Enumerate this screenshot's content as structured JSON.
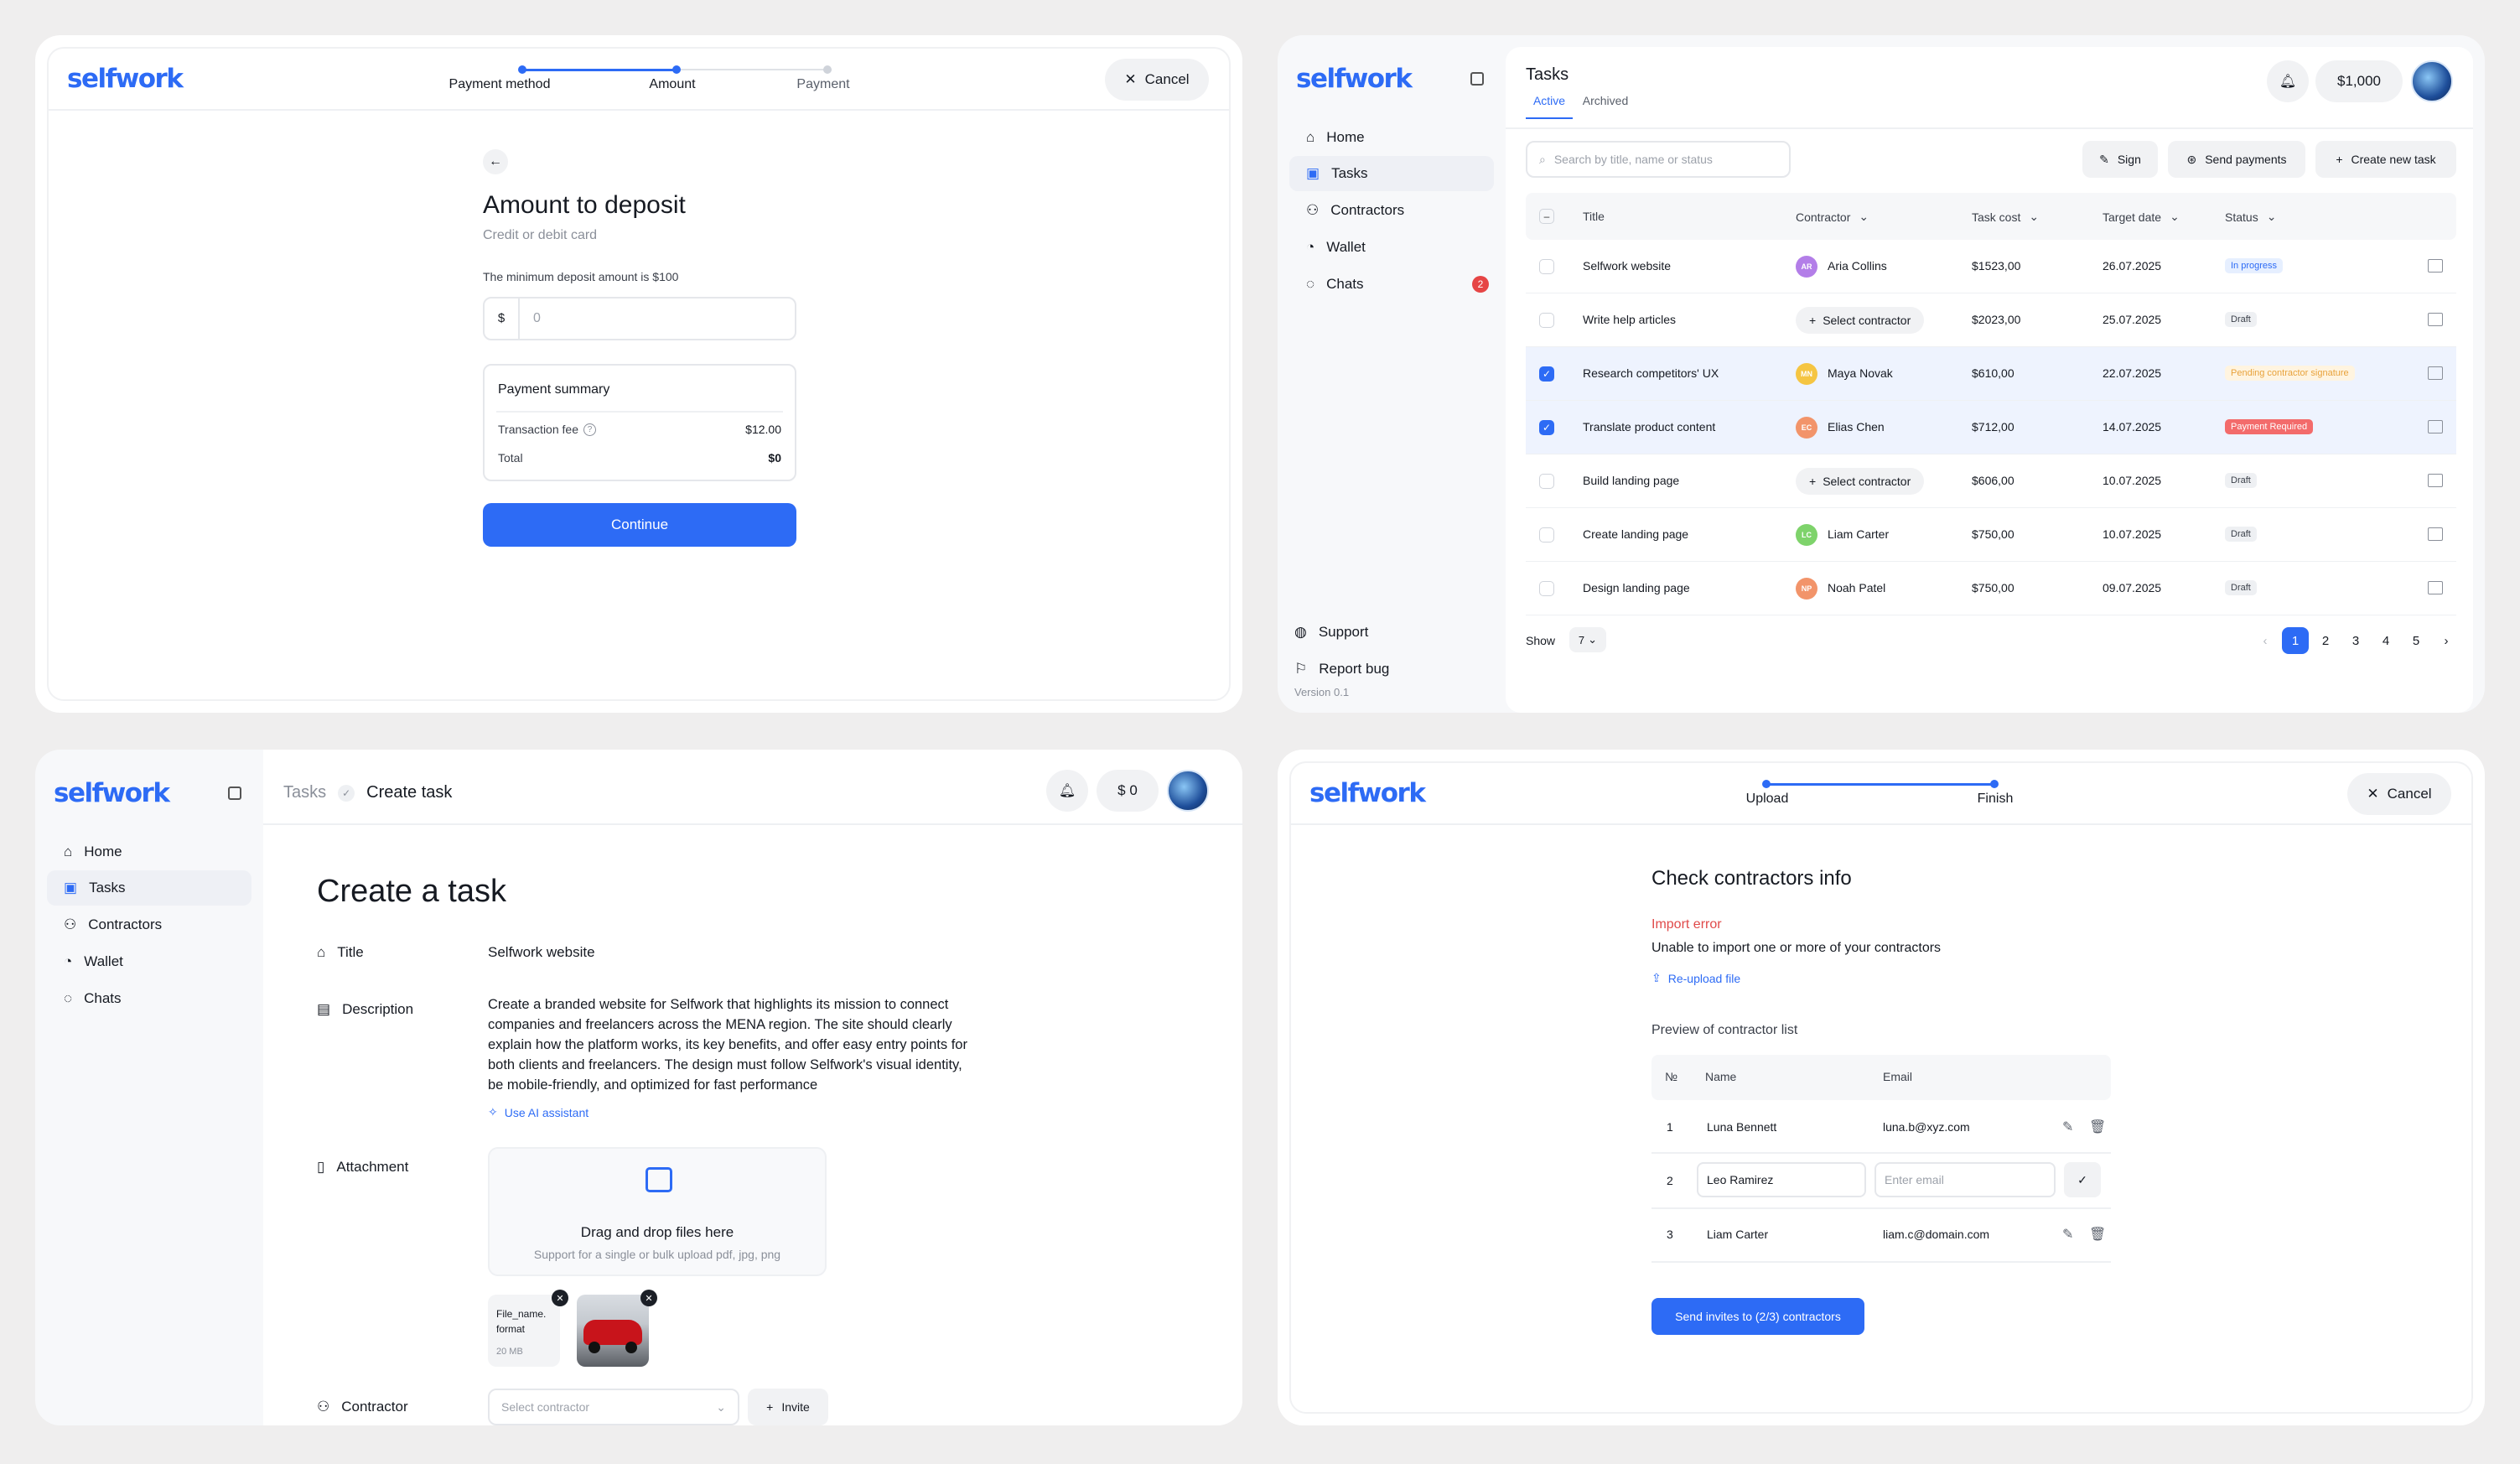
{
  "brand": {
    "logo": "selfwork",
    "accent": "#2d6bf5"
  },
  "deposit": {
    "steps": [
      "Payment method",
      "Amount",
      "Payment"
    ],
    "cancel": "Cancel",
    "title": "Amount to deposit",
    "subtitle": "Credit or debit card",
    "min_note": "The minimum deposit amount is $100",
    "currency": "$",
    "amount_placeholder": "0",
    "summary_title": "Payment summary",
    "fee_label": "Transaction fee",
    "fee_value": "$12.00",
    "total_label": "Total",
    "total_value": "$0",
    "continue": "Continue"
  },
  "tasks": {
    "sidebar": [
      {
        "label": "Home",
        "icon": "home-icon"
      },
      {
        "label": "Tasks",
        "icon": "tasks-icon"
      },
      {
        "label": "Contractors",
        "icon": "contractors-icon"
      },
      {
        "label": "Wallet",
        "icon": "wallet-icon"
      },
      {
        "label": "Chats",
        "icon": "chats-icon",
        "badge": "2"
      }
    ],
    "support": "Support",
    "report_bug": "Report bug",
    "version": "Version 0.1",
    "title": "Tasks",
    "tabs": [
      "Active",
      "Archived"
    ],
    "balance": "$1,000",
    "search_placeholder": "Search by title, name or status",
    "actions": [
      "Sign",
      "Send payments",
      "Create new task"
    ],
    "columns": [
      "Title",
      "Contractor",
      "Task cost",
      "Target date",
      "Status"
    ],
    "rows": [
      {
        "title": "Selfwork website",
        "contractor": "Aria Collins",
        "initials": "AR",
        "avatar": "#b37ee8",
        "cost": "$1523,00",
        "date": "26.07.2025",
        "status": "In progress",
        "status_type": "progress",
        "checked": false
      },
      {
        "title": "Write help articles",
        "contractor": "Select contractor",
        "initials": "",
        "avatar": "",
        "cost": "$2023,00",
        "date": "25.07.2025",
        "status": "Draft",
        "status_type": "draft",
        "checked": false
      },
      {
        "title": "Research competitors' UX",
        "contractor": "Maya Novak",
        "initials": "MN",
        "avatar": "#f5c542",
        "cost": "$610,00",
        "date": "22.07.2025",
        "status": "Pending contractor signature",
        "status_type": "pending",
        "checked": true
      },
      {
        "title": "Translate product content",
        "contractor": "Elias Chen",
        "initials": "EC",
        "avatar": "#f2946a",
        "cost": "$712,00",
        "date": "14.07.2025",
        "status": "Payment Required",
        "status_type": "required",
        "checked": true
      },
      {
        "title": "Build landing page",
        "contractor": "Select contractor",
        "initials": "",
        "avatar": "",
        "cost": "$606,00",
        "date": "10.07.2025",
        "status": "Draft",
        "status_type": "draft",
        "checked": false
      },
      {
        "title": "Create landing page",
        "contractor": "Liam Carter",
        "initials": "LC",
        "avatar": "#7ed36b",
        "cost": "$750,00",
        "date": "10.07.2025",
        "status": "Draft",
        "status_type": "draft",
        "checked": false
      },
      {
        "title": "Design landing page",
        "contractor": "Noah Patel",
        "initials": "NP",
        "avatar": "#f2946a",
        "cost": "$750,00",
        "date": "09.07.2025",
        "status": "Draft",
        "status_type": "draft",
        "checked": false
      }
    ],
    "show_label": "Show",
    "page_size": "7",
    "pages": [
      "1",
      "2",
      "3",
      "4",
      "5"
    ]
  },
  "create": {
    "breadcrumb_parent": "Tasks",
    "breadcrumb_current": "Create task",
    "balance": "$ 0",
    "heading": "Create a task",
    "title_label": "Title",
    "title_value": "Selfwork website",
    "description_label": "Description",
    "description_value": "Create a branded website for Selfwork that highlights its mission to connect companies and freelancers across the MENA region. The site should clearly explain how the platform works, its key benefits, and offer easy entry points for both clients and freelancers. The design must follow Selfwork's visual identity, be mobile-friendly, and optimized for fast performance",
    "ai_assistant": "Use AI assistant",
    "attachment_label": "Attachment",
    "drop_title": "Drag and drop files here",
    "drop_sub": "Support for a single or bulk upload pdf, jpg, png",
    "file_name": "File_name.\nformat",
    "file_size": "20 MB",
    "contractor_label": "Contractor",
    "contractor_placeholder": "Select contractor",
    "invite": "Invite"
  },
  "import": {
    "steps": [
      "Upload",
      "Finish"
    ],
    "cancel": "Cancel",
    "title": "Check contractors info",
    "error_title": "Import error",
    "error_text": "Unable to import one or more of your contractors",
    "reupload": "Re-upload file",
    "preview_title": "Preview of contractor list",
    "columns": [
      "№",
      "Name",
      "Email"
    ],
    "rows": [
      {
        "n": "1",
        "name": "Luna Bennett",
        "email": "luna.b@xyz.com"
      },
      {
        "n": "2",
        "name": "Leo Ramirez",
        "email": "",
        "email_placeholder": "Enter email"
      },
      {
        "n": "3",
        "name": "Liam Carter",
        "email": "liam.c@domain.com"
      }
    ],
    "send": "Send invites to (2/3) contractors"
  }
}
